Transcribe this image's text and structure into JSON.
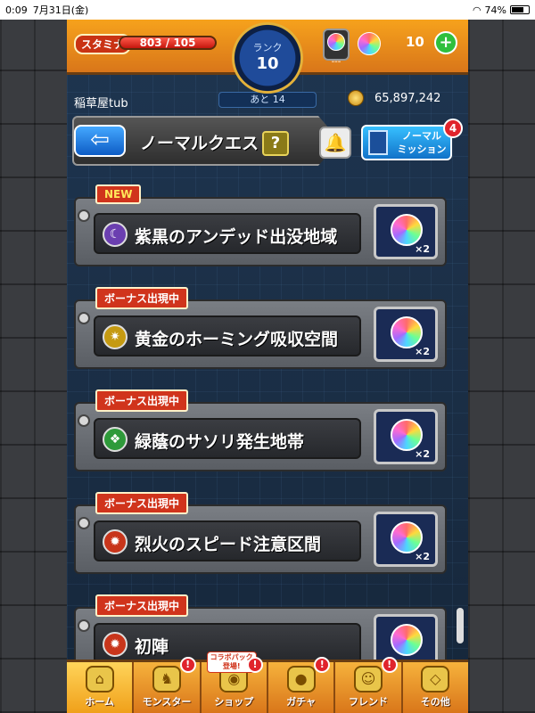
{
  "status_bar": {
    "time": "0:09",
    "date": "7月31日(金)",
    "battery_level": "74%",
    "battery_fraction": 0.74
  },
  "header": {
    "stamina_label": "スタミナ",
    "stamina_value": "803 / 105",
    "stamina_fraction": 1.0,
    "rank_label": "ランク",
    "rank_value": "10",
    "gem_slot_text": "---",
    "orb_count": "10",
    "plus_label": "+"
  },
  "subheader": {
    "player_name": "稲草屋tub",
    "next_rank": "あと 14",
    "coins": "65,897,242"
  },
  "quest_header": {
    "back_glyph": "⇦",
    "title": "ノーマルクエスト",
    "help_label": "?",
    "mission_label_line1": "ノーマル",
    "mission_label_line2": "ミッション",
    "mission_badge": "4"
  },
  "quests": [
    {
      "tag": "NEW",
      "name": "紫黒のアンデッド出没地域",
      "icon_color": "#6b3fb0",
      "icon_glyph": "☾",
      "reward": "×2"
    },
    {
      "tag": "ボーナス出現中",
      "name": "黄金のホーミング吸収空間",
      "icon_color": "#c59a12",
      "icon_glyph": "✷",
      "reward": "×2"
    },
    {
      "tag": "ボーナス出現中",
      "name": "緑蔭のサソリ発生地帯",
      "icon_color": "#2e9a3a",
      "icon_glyph": "❖",
      "reward": "×2"
    },
    {
      "tag": "ボーナス出現中",
      "name": "烈火のスピード注意区間",
      "icon_color": "#c8351b",
      "icon_glyph": "✹",
      "reward": "×2"
    },
    {
      "tag": "ボーナス出現中",
      "name": "初陣",
      "icon_color": "#c8351b",
      "icon_glyph": "✹",
      "reward": ""
    }
  ],
  "bottom_nav": [
    {
      "label": "ホーム",
      "icon": "home-icon",
      "glyph": "⌂",
      "alert": ""
    },
    {
      "label": "モンスター",
      "icon": "monster-icon",
      "glyph": "♞",
      "alert": "!"
    },
    {
      "label": "ショップ",
      "icon": "shop-icon",
      "glyph": "◉",
      "alert": "!",
      "badge": "コラボパック 登場!"
    },
    {
      "label": "ガチャ",
      "icon": "gacha-icon",
      "glyph": "●",
      "alert": "!"
    },
    {
      "label": "フレンド",
      "icon": "friend-icon",
      "glyph": "☺",
      "alert": "!"
    },
    {
      "label": "その他",
      "icon": "other-icon",
      "glyph": "◇",
      "alert": ""
    }
  ]
}
